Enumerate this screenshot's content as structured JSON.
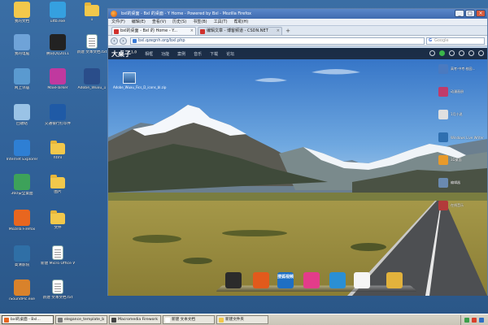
{
  "desktop_icons": [
    {
      "label": "我的文档",
      "icon": "my-documents-icon",
      "color": "#f2c84b"
    },
    {
      "label": "ultb.exe",
      "icon": "app-icon",
      "color": "#35a0e0"
    },
    {
      "label": "1",
      "icon": "folder-icon",
      "color": "#f2c84b"
    },
    {
      "label": "我的电脑",
      "icon": "my-computer-icon",
      "color": "#6fa3d8"
    },
    {
      "label": "腾讯QQ2011",
      "icon": "qq-icon",
      "color": "#222222"
    },
    {
      "label": "新建 文本文档.txt",
      "icon": "text-file-icon",
      "color": "#ffffff"
    },
    {
      "label": "网上邻居",
      "icon": "network-icon",
      "color": "#5a9ad0"
    },
    {
      "label": "MaxFlarker",
      "icon": "app-icon",
      "color": "#c0399f"
    },
    {
      "label": "Adobe_Wuxu_1",
      "icon": "app-icon",
      "color": "#2a4d8a"
    },
    {
      "label": "回收站",
      "icon": "recycle-bin-icon",
      "color": "#9ac3e6"
    },
    {
      "label": "交通银行打印件",
      "icon": "bank-icon",
      "color": "#1f5aa6"
    },
    {
      "label": "Internet Explorer",
      "icon": "ie-icon",
      "color": "#2e7fd4"
    },
    {
      "label": "html",
      "icon": "folder-icon",
      "color": "#f2c84b"
    },
    {
      "label": "360安全桌面",
      "icon": "app-icon",
      "color": "#3da25a"
    },
    {
      "label": "图片",
      "icon": "folder-icon",
      "color": "#f2c84b"
    },
    {
      "label": "Mozilla Firefox",
      "icon": "firefox-icon",
      "color": "#e8661f"
    },
    {
      "label": "文件",
      "icon": "folder-icon",
      "color": "#f2c84b"
    },
    {
      "label": "高清影院",
      "icon": "video-icon",
      "color": "#2f6fa6"
    },
    {
      "label": "新建 Micro Office Wor",
      "icon": "doc-icon",
      "color": "#ffffff"
    },
    {
      "label": "iSoundPic.exe",
      "icon": "app-icon",
      "color": "#d9822b"
    },
    {
      "label": "新建 文本文档.txt",
      "icon": "text-file-icon",
      "color": "#ffffff"
    }
  ],
  "browser": {
    "title": "bxl的桌面 - Bxl 的桌面 - Y Home - Powered by Bxl - Mozilla Firefox",
    "menu": [
      "文件(F)",
      "编辑(E)",
      "查看(V)",
      "历史(S)",
      "书签(B)",
      "工具(T)",
      "帮助(H)"
    ],
    "tabs": [
      {
        "label": "bxl的桌面 - Bxl 的 Home - Y...",
        "active": true
      },
      {
        "label": "编辑文章 - 博客频道 - CSDN.NET",
        "active": false
      }
    ],
    "url": "bxl.qzegnh.org/bxl.php",
    "search_placeholder": "Google",
    "win_buttons": [
      "_",
      "□",
      "×"
    ]
  },
  "webpage": {
    "brand": "大桌子",
    "brand_version": "1.0",
    "nav": [
      "相框",
      "功能",
      "案例",
      "音乐",
      "下载",
      "论坛"
    ],
    "desktop_file": "Adobe_Wuxu_Fics_D_icons_bl.zip",
    "right_apps": [
      {
        "label": "高考·中考·校园...",
        "color": "#4a7ac0"
      },
      {
        "label": "动漫画册",
        "color": "#c03b6a"
      },
      {
        "label": "1月小说",
        "color": "#e0e0e0"
      },
      {
        "label": "Windows Live Writer",
        "color": "#2f6fb0"
      },
      {
        "label": "3D桌面",
        "color": "#e89a2a"
      },
      {
        "label": "编辑器",
        "color": "#6a8ab0"
      },
      {
        "label": "在线音乐",
        "color": "#b33a3a"
      }
    ],
    "dock": [
      {
        "name": "film-app-icon",
        "color": "#2b2b2b",
        "text": ""
      },
      {
        "name": "trend-app-icon",
        "color": "#e25a1c",
        "text": ""
      },
      {
        "name": "search-app-icon",
        "color": "#1e6fc4",
        "text": "搜狐视频"
      },
      {
        "name": "color-app-icon",
        "color": "#e33c8a",
        "text": ""
      },
      {
        "name": "globe-app-icon",
        "color": "#2a8fd4",
        "text": ""
      },
      {
        "name": "notes-app-icon",
        "color": "#f5f5f5",
        "text": ""
      },
      {
        "name": "folder-app-icon",
        "color": "#e2b23c",
        "text": ""
      }
    ]
  },
  "taskbar": {
    "buttons": [
      {
        "label": "bxl的桌面 - Bxl...",
        "color": "#e8661f",
        "active": true
      },
      {
        "label": "elegance_template_b",
        "color": "#7a7a7a",
        "active": false
      },
      {
        "label": "Macromedia Firework",
        "color": "#444444",
        "active": false
      },
      {
        "label": "新建 文本文档",
        "color": "#ffffff",
        "active": false
      },
      {
        "label": "新建文件夹",
        "color": "#f2c84b",
        "active": false
      }
    ]
  }
}
